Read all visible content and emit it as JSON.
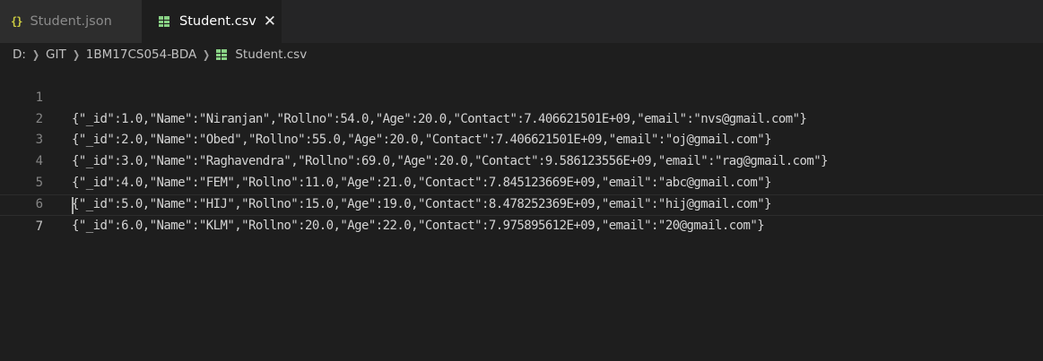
{
  "tabs": [
    {
      "label": "Student.json",
      "icon": "json-icon",
      "active": false
    },
    {
      "label": "Student.csv",
      "icon": "csv-file-icon",
      "active": true
    }
  ],
  "breadcrumb": {
    "items": [
      "D:",
      "GIT",
      "1BM17CS054-BDA",
      "Student.csv"
    ]
  },
  "editor": {
    "lines": [
      {
        "number": "1",
        "text": "{\"_id\":1.0,\"Name\":\"Niranjan\",\"Rollno\":54.0,\"Age\":20.0,\"Contact\":7.406621501E+09,\"email\":\"nvs@gmail.com\"}"
      },
      {
        "number": "2",
        "text": "{\"_id\":2.0,\"Name\":\"Obed\",\"Rollno\":55.0,\"Age\":20.0,\"Contact\":7.406621501E+09,\"email\":\"oj@gmail.com\"}"
      },
      {
        "number": "3",
        "text": "{\"_id\":3.0,\"Name\":\"Raghavendra\",\"Rollno\":69.0,\"Age\":20.0,\"Contact\":9.586123556E+09,\"email\":\"rag@gmail.com\"}"
      },
      {
        "number": "4",
        "text": "{\"_id\":4.0,\"Name\":\"FEM\",\"Rollno\":11.0,\"Age\":21.0,\"Contact\":7.845123669E+09,\"email\":\"abc@gmail.com\"}"
      },
      {
        "number": "5",
        "text": "{\"_id\":5.0,\"Name\":\"HIJ\",\"Rollno\":15.0,\"Age\":19.0,\"Contact\":8.478252369E+09,\"email\":\"hij@gmail.com\"}"
      },
      {
        "number": "6",
        "text": "{\"_id\":6.0,\"Name\":\"KLM\",\"Rollno\":20.0,\"Age\":22.0,\"Contact\":7.975895612E+09,\"email\":\"20@gmail.com\"}"
      },
      {
        "number": "7",
        "text": ""
      }
    ]
  },
  "colors": {
    "editor_background": "#1e1e1e",
    "tabbar_background": "#252526",
    "json_icon": "#cbcb41",
    "csv_icon": "#89d185",
    "line_number": "#858585",
    "text": "#d4d4d4"
  }
}
